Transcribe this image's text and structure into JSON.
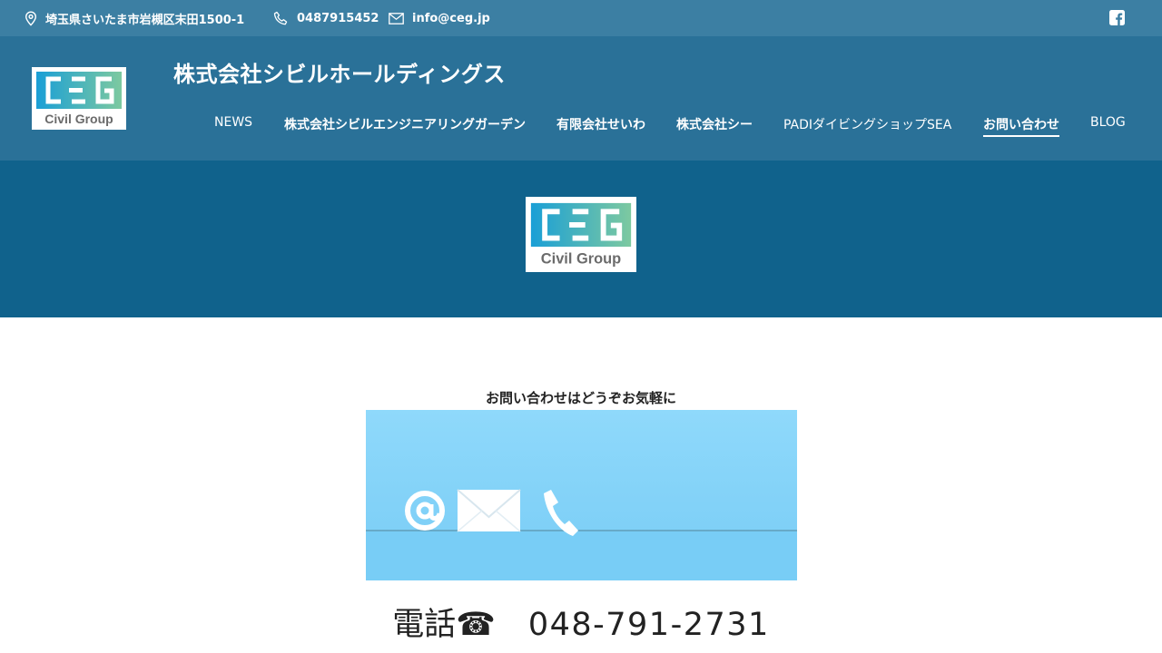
{
  "topbar": {
    "address": "埼玉県さいたま市岩槻区末田1500-1",
    "phone": "0487915452",
    "email": "info@ceg.jp",
    "icons": {
      "address": "map-pin-icon",
      "phone": "phone-icon",
      "email": "mail-icon",
      "social": "facebook-icon"
    }
  },
  "header": {
    "site_title": "株式会社シビルホールディングス",
    "logo": {
      "mark": "CEG",
      "tagline": "Civil Group"
    }
  },
  "nav": {
    "items": [
      {
        "label": "NEWS"
      },
      {
        "label": "株式会社シビルエンジニアリングガーデン"
      },
      {
        "label": "有限会社せいわ"
      },
      {
        "label": "株式会社シー"
      },
      {
        "label": "PADIダイビングショップSEA"
      },
      {
        "label": "お問い合わせ",
        "active": true
      },
      {
        "label": "BLOG"
      }
    ]
  },
  "content": {
    "heading": "お問い合わせはどうぞお気軽に",
    "phone_label": "電話☎",
    "phone_number": "048-791-2731"
  },
  "colors": {
    "topbar": "#3c7fa3",
    "header": "#2a7198",
    "hero": "#10628c",
    "logo_gradient_start": "#1a9fd6",
    "logo_gradient_end": "#7dc9a0",
    "logo_text": "#6b6b6b"
  }
}
